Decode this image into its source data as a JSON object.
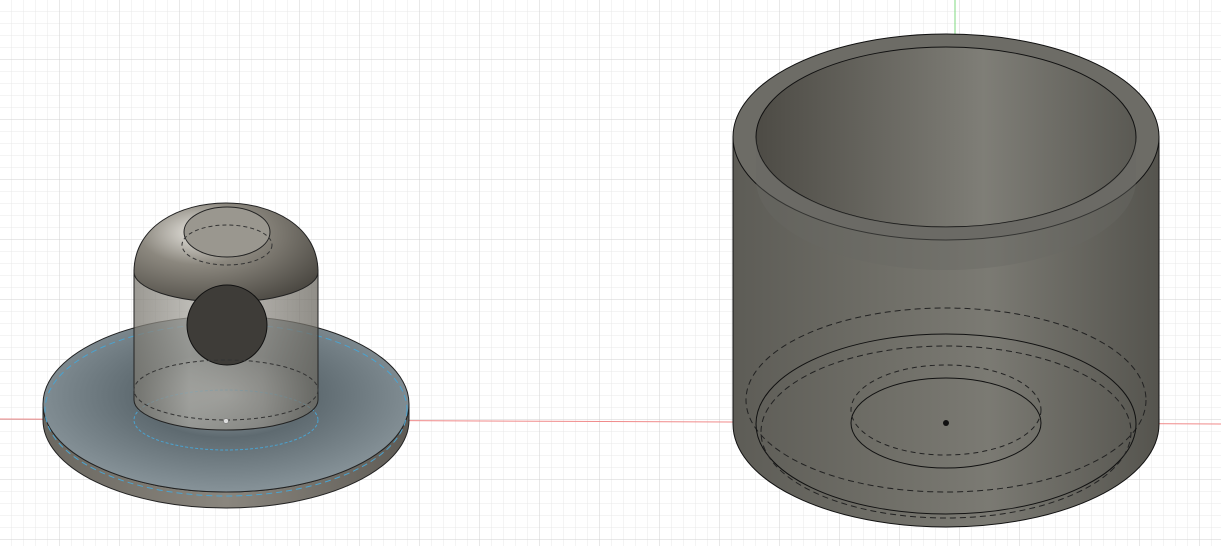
{
  "viewport": {
    "background": "#ffffff",
    "grid_minor_color": "#e6e6e6",
    "grid_major_color": "#cfcfcf",
    "x_axis_color": "#f08080",
    "y_axis_color": "#7fd97f"
  },
  "bodies": [
    {
      "name": "knob-with-base"
    },
    {
      "name": "cylindrical-cup"
    }
  ]
}
